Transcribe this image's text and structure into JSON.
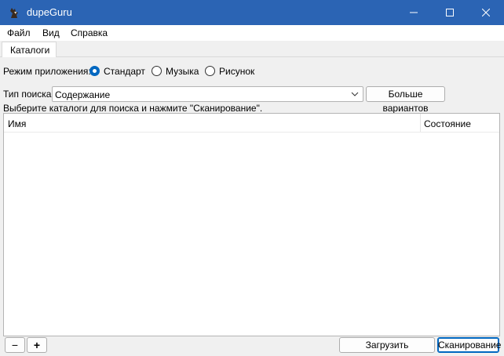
{
  "window": {
    "title": "dupeGuru"
  },
  "menu": {
    "items": [
      "Файл",
      "Вид",
      "Справка"
    ]
  },
  "tabs": [
    {
      "label": "Каталоги"
    }
  ],
  "app_mode": {
    "label": "Режим приложения:",
    "options": [
      "Стандарт",
      "Музыка",
      "Рисунок"
    ],
    "selected": "Стандарт"
  },
  "scan_type": {
    "label": "Тип поиска:",
    "value": "Содержание"
  },
  "more_options_button": "Больше вариантов",
  "hint": "Выберите каталоги для поиска и нажмите \"Сканирование\".",
  "directory_tree": {
    "columns": [
      "Имя",
      "Состояние"
    ]
  },
  "footer": {
    "remove_label": "−",
    "add_label": "+",
    "load_results_label": "Загрузить результаты",
    "scan_label": "Сканирование"
  },
  "colors": {
    "titlebar": "#2b64b4",
    "accent": "#0067c0"
  }
}
